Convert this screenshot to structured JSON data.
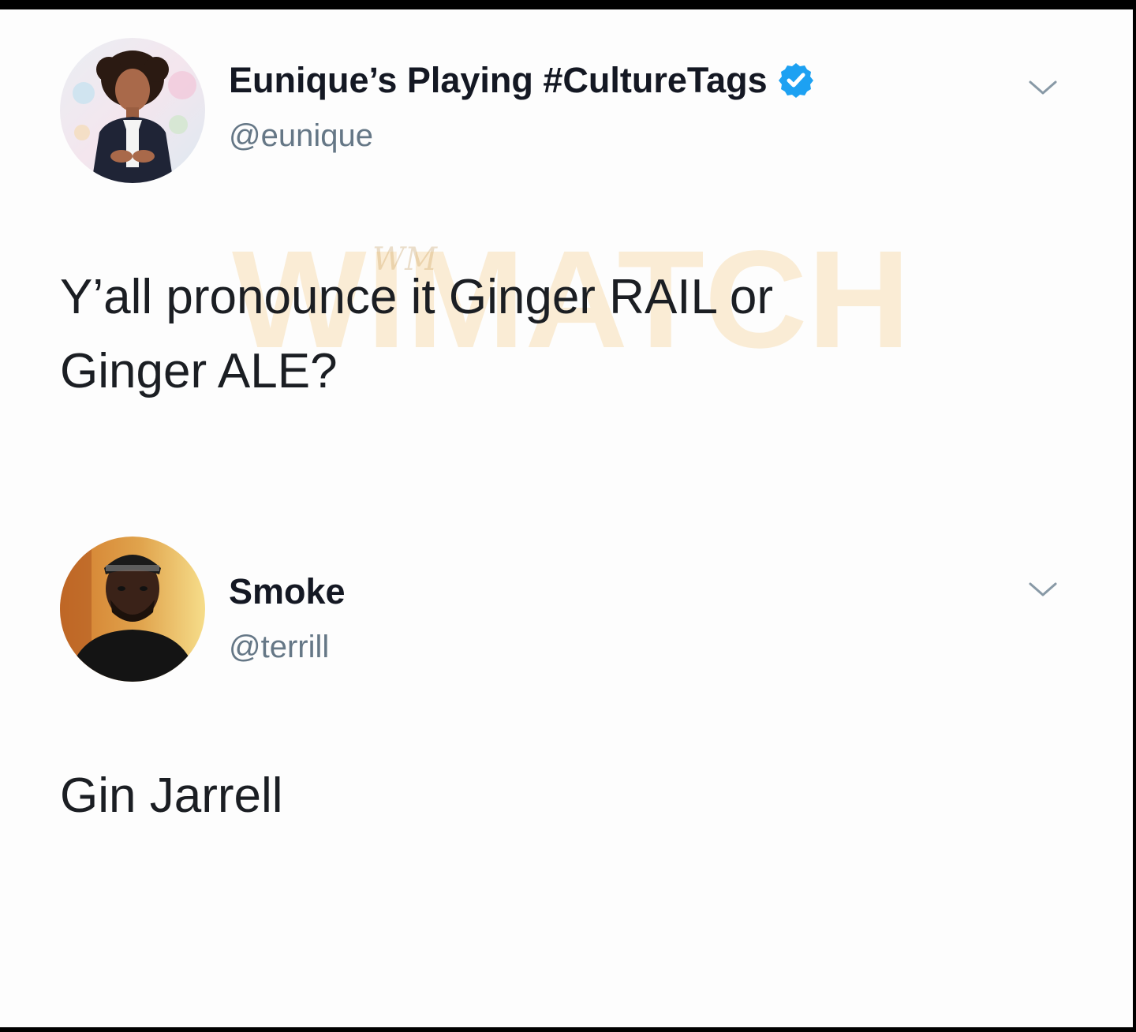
{
  "tweets": [
    {
      "display_name": "Eunique’s Playing #CultureTags",
      "handle": "@eunique",
      "verified": true,
      "text_lines": [
        "Y’all pronounce it Ginger RAIL or",
        "Ginger ALE?"
      ],
      "avatar_icon": "profile-photo-woman",
      "menu_icon": "chevron-down-icon"
    },
    {
      "display_name": "Smoke",
      "handle": "@terrill",
      "verified": false,
      "text_lines": [
        "Gin Jarrell"
      ],
      "avatar_icon": "profile-photo-man",
      "menu_icon": "chevron-down-icon"
    }
  ],
  "watermark": {
    "text": "WIMATCH",
    "mark": "WM"
  },
  "colors": {
    "background": "#fdfdfd",
    "frame": "#000000",
    "name": "#141823",
    "handle": "#657786",
    "text": "#1b1e23",
    "verified": "#1da1f2",
    "watermark": "#f0b24a"
  }
}
